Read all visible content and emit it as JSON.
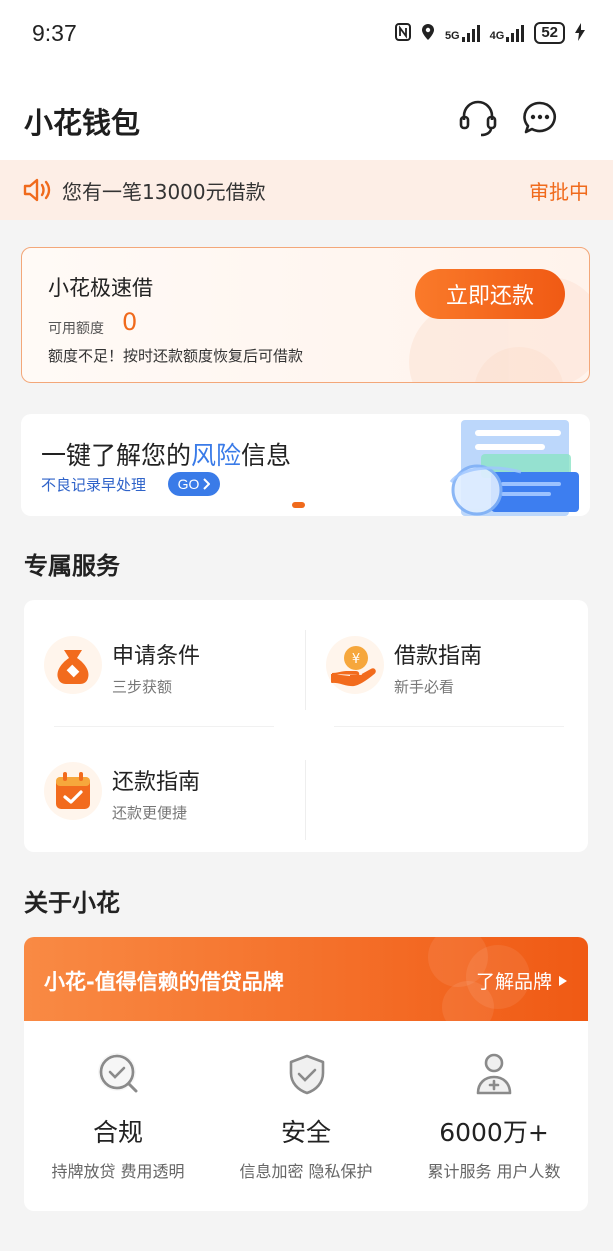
{
  "status_bar": {
    "time": "9:37",
    "network_1": "5G",
    "network_2": "4G",
    "battery": "52"
  },
  "header": {
    "title": "小花钱包",
    "icons": [
      "headset-icon",
      "chat-icon"
    ]
  },
  "notice": {
    "text": "您有一笔13000元借款",
    "status": "审批中",
    "icon": "speaker-icon"
  },
  "loan_card": {
    "title": "小花极速借",
    "credit_label": "可用额度",
    "credit_value": "0",
    "note": "额度不足！按时还款额度恢复后可借款",
    "button": "立即还款"
  },
  "risk_banner": {
    "title_prefix": "一键了解您的",
    "title_highlight": "风险",
    "title_suffix": "信息",
    "subtitle": "不良记录早处理",
    "go_label": "GO",
    "colors": {
      "highlight": "#3a7be8"
    }
  },
  "services": {
    "title": "专属服务",
    "items": [
      {
        "name": "申请条件",
        "desc": "三步获额",
        "icon": "money-bag-icon"
      },
      {
        "name": "借款指南",
        "desc": "新手必看",
        "icon": "hand-coin-icon"
      },
      {
        "name": "还款指南",
        "desc": "还款更便捷",
        "icon": "calendar-check-icon"
      }
    ]
  },
  "about": {
    "title": "关于小花",
    "banner_text": "小花-值得信赖的借贷品牌",
    "banner_link": "了解品牌",
    "columns": [
      {
        "head": "合规",
        "sub": "持牌放贷  费用透明",
        "icon": "compliance-check-icon"
      },
      {
        "head": "安全",
        "sub": "信息加密  隐私保护",
        "icon": "shield-check-icon"
      },
      {
        "head": "6000万+",
        "sub": "累计服务  用户人数",
        "icon": "user-plus-icon"
      }
    ]
  },
  "colors": {
    "accent": "#f06a1c",
    "notice_bg": "#fdeee6",
    "link_blue": "#3a7be8"
  }
}
